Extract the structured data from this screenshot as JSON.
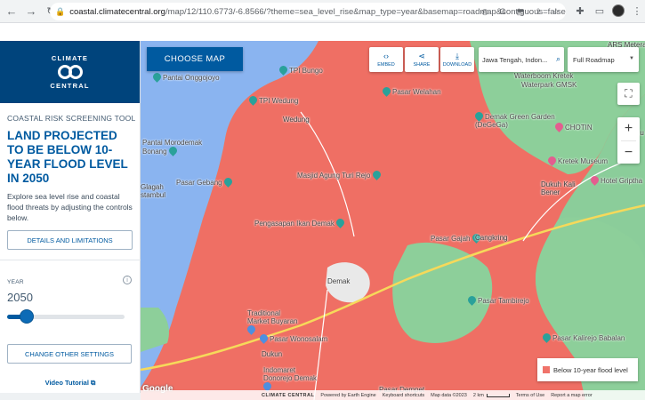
{
  "browser": {
    "url_host": "coastal.climatecentral.org",
    "url_rest": "/map/12/110.6773/-6.8566/?theme=sea_level_rise&map_type=year&basemap=roadmap&contiguous=false&elevation_m..."
  },
  "sidebar": {
    "brand_top": "CLIMATE",
    "brand_bottom": "CENTRAL",
    "tool_label": "COASTAL RISK SCREENING TOOL",
    "headline": "LAND PROJECTED TO BE BELOW 10-YEAR FLOOD LEVEL IN 2050",
    "description": "Explore sea level rise and coastal flood threats by adjusting the controls below.",
    "details_button": "DETAILS AND LIMITATIONS",
    "year_label": "YEAR",
    "year_value": "2050",
    "year_slider_fraction": 0.08,
    "change_settings_button": "CHANGE OTHER SETTINGS",
    "video_tutorial": "Video Tutorial"
  },
  "map": {
    "choose_map_button": "CHOOSE MAP",
    "tools": [
      {
        "label": "EMBED",
        "icon": "code-icon"
      },
      {
        "label": "SHARE",
        "icon": "share-icon"
      },
      {
        "label": "DOWNLOAD",
        "icon": "download-icon"
      }
    ],
    "search_value": "Jawa Tengah, Indon...",
    "basemap_value": "Full Roadmap",
    "legend_label": "Below 10-year flood level",
    "legend_color": "#f0736a",
    "places": [
      {
        "name": "TPI Bungo",
        "kind": "teal"
      },
      {
        "name": "Pantai Onggojoyo",
        "kind": "teal"
      },
      {
        "name": "TPI Wedung",
        "kind": "teal"
      },
      {
        "name": "Wedung",
        "kind": "plain"
      },
      {
        "name": "Pasar Welahan",
        "kind": "teal"
      },
      {
        "name": "Waterboom Kretek",
        "kind": "plain"
      },
      {
        "name": "Waterpark GMSK",
        "kind": "plain"
      },
      {
        "name": "Demak Green Garden (DeGeGa)",
        "kind": "teal"
      },
      {
        "name": "CHOTIN",
        "kind": "pink"
      },
      {
        "name": "Pantai Morodemak Bonang",
        "kind": "teal"
      },
      {
        "name": "Kretek Museum",
        "kind": "pink"
      },
      {
        "name": "Hotel Griptha",
        "kind": "pink"
      },
      {
        "name": "Dukuh Kali Bener",
        "kind": "plain"
      },
      {
        "name": "Masjid Agung Turi Rejo",
        "kind": "teal"
      },
      {
        "name": "Pasar Gebang",
        "kind": "teal"
      },
      {
        "name": "Glagah",
        "kind": "plain"
      },
      {
        "name": "Pengasapan Ikan Demak",
        "kind": "teal"
      },
      {
        "name": "Pasar Gajah",
        "kind": "teal"
      },
      {
        "name": "Cangkring",
        "kind": "plain"
      },
      {
        "name": "Demak",
        "kind": "plain"
      },
      {
        "name": "Pasar Tambirejo",
        "kind": "teal"
      },
      {
        "name": "Traditional Market Buyaran",
        "kind": "blue"
      },
      {
        "name": "Pasar Wonosalam",
        "kind": "blue"
      },
      {
        "name": "Pasar Kalirejo Babalan",
        "kind": "teal"
      },
      {
        "name": "Dukun",
        "kind": "plain"
      },
      {
        "name": "Indomaret Donorejo Demak",
        "kind": "blue"
      }
    ],
    "edge_labels": [
      "ARS Meteran",
      "Ku",
      "stambul",
      "Pasar Dempet"
    ],
    "attribution": {
      "google": "Google",
      "climate_central": "CLIMATE CENTRAL",
      "powered": "Powered by Earth Engine",
      "shortcuts": "Keyboard shortcuts",
      "data": "Map data ©2023",
      "scale": "2 km",
      "terms": "Terms of Use",
      "report": "Report a map error"
    }
  }
}
